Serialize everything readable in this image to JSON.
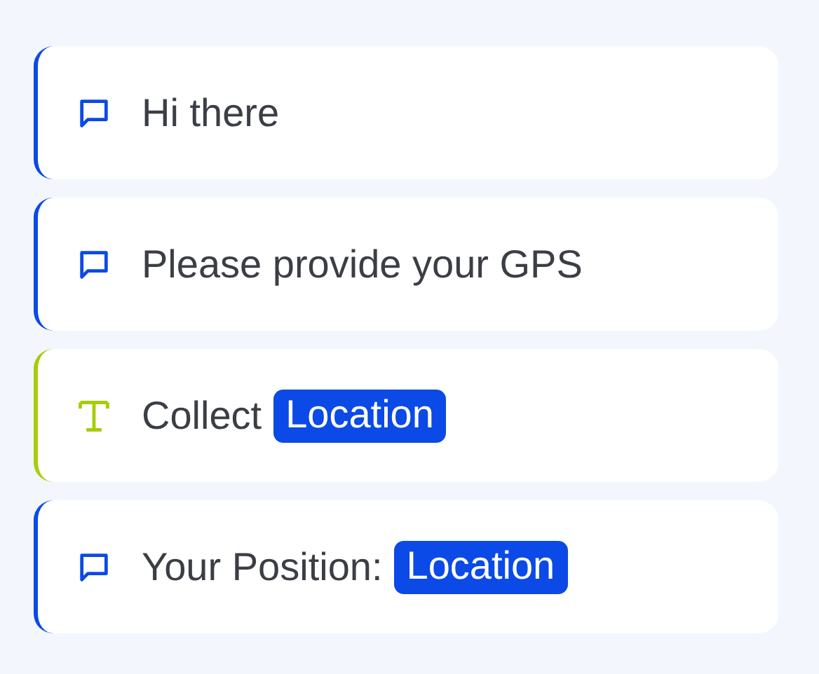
{
  "steps": [
    {
      "kind": "message",
      "color": "#0b4ae6",
      "parts": [
        {
          "kind": "text",
          "text": "Hi there"
        }
      ]
    },
    {
      "kind": "message",
      "color": "#0b4ae6",
      "parts": [
        {
          "kind": "text",
          "text": "Please provide your GPS"
        }
      ]
    },
    {
      "kind": "input",
      "color": "#a6cc0a",
      "parts": [
        {
          "kind": "text",
          "text": "Collect"
        },
        {
          "kind": "variable",
          "text": "Location"
        }
      ]
    },
    {
      "kind": "message",
      "color": "#0b4ae6",
      "parts": [
        {
          "kind": "text",
          "text": "Your Position:"
        },
        {
          "kind": "variable",
          "text": "Location"
        }
      ]
    }
  ]
}
